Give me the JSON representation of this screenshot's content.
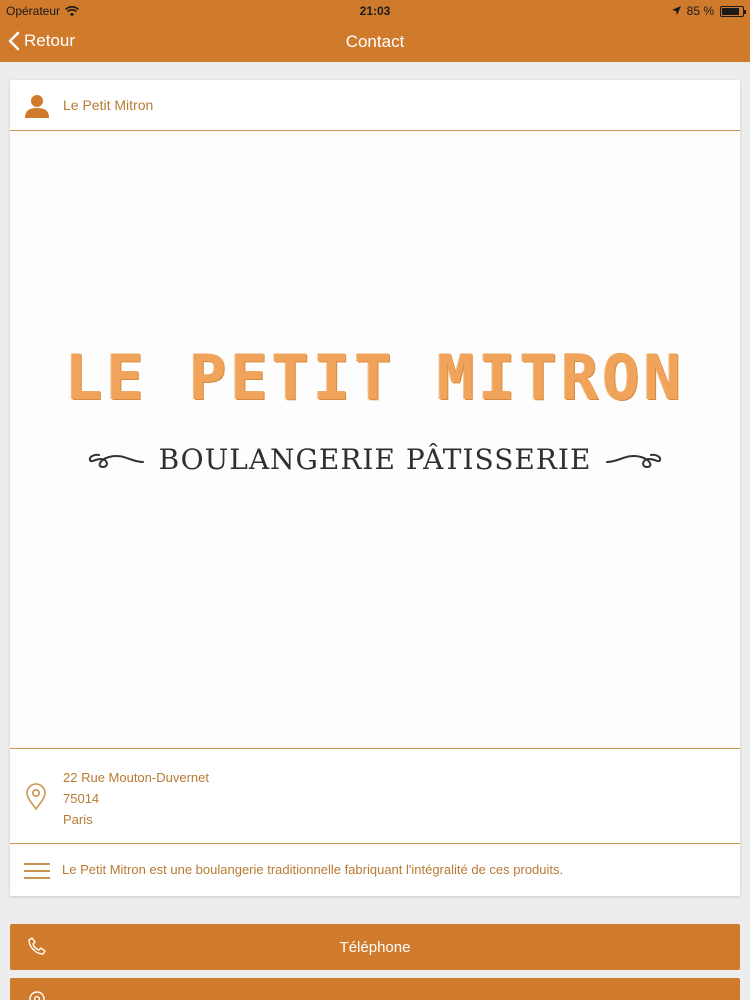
{
  "status_bar": {
    "carrier": "Opérateur",
    "time": "21:03",
    "battery": "85 %",
    "battery_level": 0.85
  },
  "nav": {
    "back_label": "Retour",
    "title": "Contact"
  },
  "contact": {
    "name": "Le Petit Mitron",
    "logo": {
      "title": "LE PETIT MITRON",
      "subtitle": "BOULANGERIE PÂTISSERIE"
    },
    "address": {
      "street": "22 Rue Mouton-Duvernet",
      "postal_code": "75014",
      "city": "Paris"
    },
    "description": "Le Petit Mitron est une boulangerie traditionnelle fabriquant l'intégralité de ces produits."
  },
  "actions": {
    "phone_label": "Téléphone",
    "map_label": ""
  },
  "colors": {
    "accent": "#d07a2c",
    "text_accent": "#b87a33",
    "divider": "#c8954f"
  },
  "icons": [
    "wifi-icon",
    "location-arrow-icon",
    "chevron-left-icon",
    "person-icon",
    "map-pin-icon",
    "menu-lines-icon",
    "phone-icon"
  ]
}
